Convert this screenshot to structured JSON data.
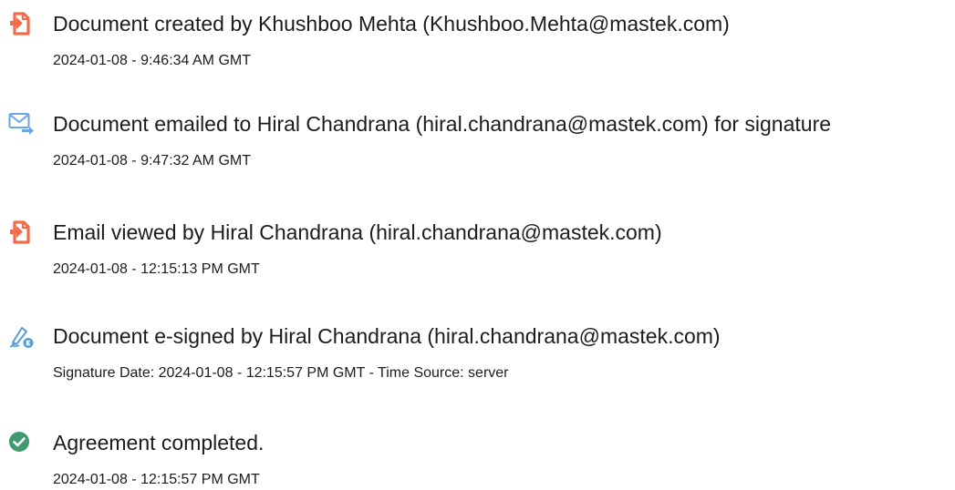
{
  "events": [
    {
      "icon": "document-created-icon",
      "title": "Document created by Khushboo Mehta (Khushboo.Mehta@mastek.com)",
      "meta": "2024-01-08 - 9:46:34 AM GMT"
    },
    {
      "icon": "email-sent-icon",
      "title": "Document emailed to Hiral Chandrana (hiral.chandrana@mastek.com) for signature",
      "meta": "2024-01-08 - 9:47:32 AM GMT"
    },
    {
      "icon": "document-viewed-icon",
      "title": "Email viewed by Hiral Chandrana (hiral.chandrana@mastek.com)",
      "meta": "2024-01-08 - 12:15:13 PM GMT"
    },
    {
      "icon": "e-sign-pen-icon",
      "title": "Document e-signed by Hiral Chandrana (hiral.chandrana@mastek.com)",
      "meta": "Signature Date: 2024-01-08 - 12:15:57 PM GMT - Time Source: server"
    },
    {
      "icon": "completed-check-icon",
      "title": "Agreement completed.",
      "meta": "2024-01-08 - 12:15:57 PM GMT"
    }
  ],
  "colors": {
    "document_icon": "#f06c4a",
    "email_icon": "#6aa6e8",
    "sign_icon": "#4f9fd8",
    "check_icon": "#3f9a70"
  }
}
